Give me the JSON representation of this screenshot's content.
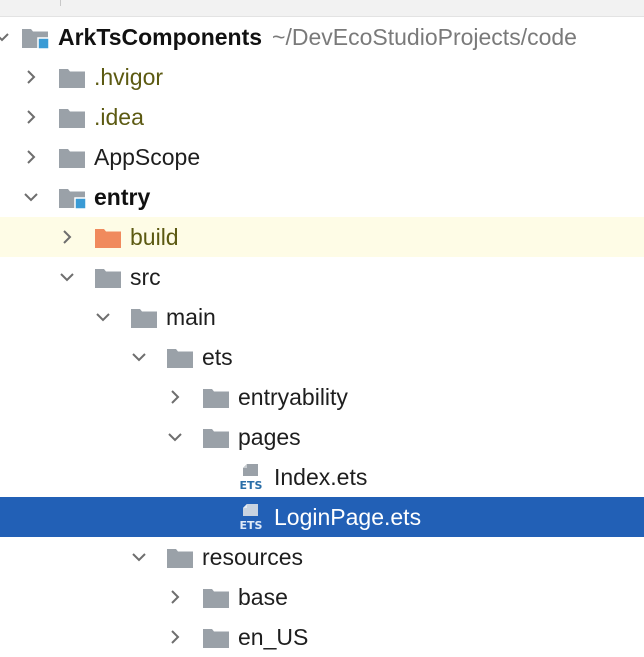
{
  "project": {
    "name": "ArkTsComponents",
    "path": "~/DevEcoStudioProjects/code"
  },
  "tree": [
    {
      "label": ".hvigor",
      "level": 1,
      "state": "collapsed",
      "icon": "folder-icon"
    },
    {
      "label": ".idea",
      "level": 1,
      "state": "collapsed",
      "icon": "folder-icon"
    },
    {
      "label": "AppScope",
      "level": 1,
      "state": "collapsed",
      "icon": "folder-icon"
    },
    {
      "label": "entry",
      "level": 1,
      "state": "expanded",
      "icon": "module-folder-icon"
    },
    {
      "label": "build",
      "level": 2,
      "state": "collapsed",
      "icon": "excluded-folder-icon"
    },
    {
      "label": "src",
      "level": 2,
      "state": "expanded",
      "icon": "folder-icon"
    },
    {
      "label": "main",
      "level": 3,
      "state": "expanded",
      "icon": "folder-icon"
    },
    {
      "label": "ets",
      "level": 4,
      "state": "expanded",
      "icon": "folder-icon"
    },
    {
      "label": "entryability",
      "level": 5,
      "state": "collapsed",
      "icon": "folder-icon"
    },
    {
      "label": "pages",
      "level": 5,
      "state": "expanded",
      "icon": "folder-icon"
    },
    {
      "label": "Index.ets",
      "level": 6,
      "state": "file",
      "icon": "ets-file-icon"
    },
    {
      "label": "LoginPage.ets",
      "level": 6,
      "state": "file",
      "icon": "ets-file-icon"
    },
    {
      "label": "resources",
      "level": 4,
      "state": "expanded",
      "icon": "folder-icon"
    },
    {
      "label": "base",
      "level": 5,
      "state": "collapsed",
      "icon": "folder-icon"
    },
    {
      "label": "en_US",
      "level": 5,
      "state": "collapsed",
      "icon": "folder-icon"
    }
  ],
  "selected_file": "LoginPage.ets",
  "colors": {
    "selection": "#2260b6",
    "highlight_row": "#fefce6",
    "folder": "#9aa1a8",
    "excluded_folder": "#f08a5d",
    "module_badge": "#3a9bd5",
    "ets_text": "#2a6ea8",
    "olive_label": "#5c5a12"
  }
}
